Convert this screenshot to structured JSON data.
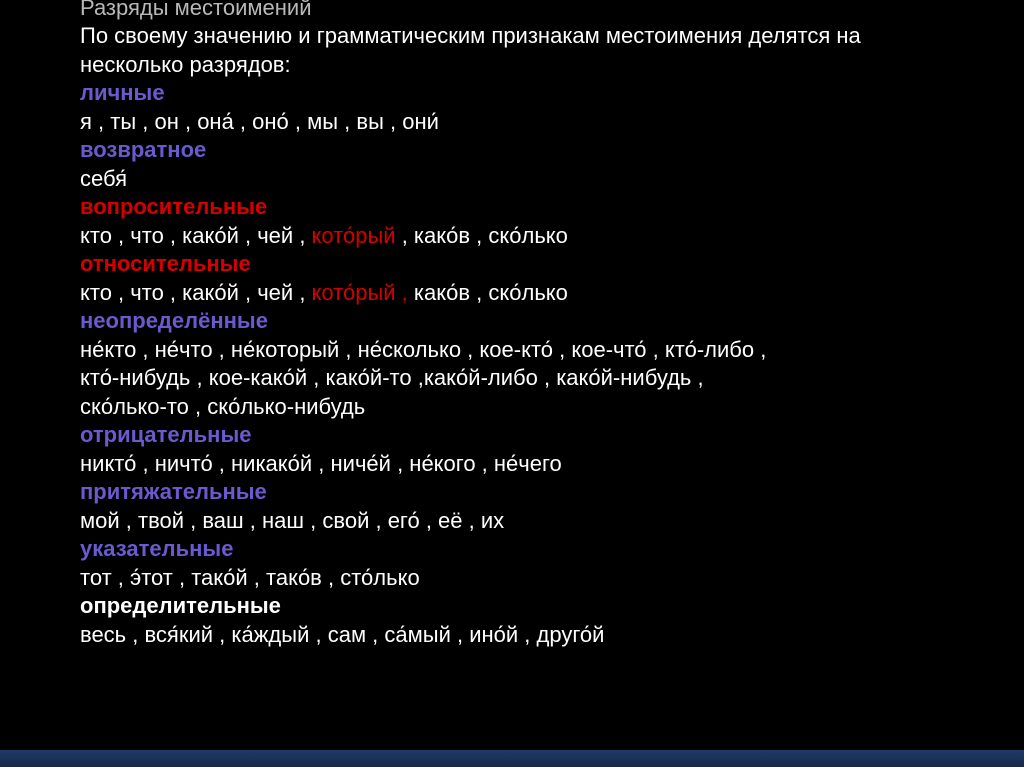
{
  "title_cut": "Разряды местоимений",
  "intro1": "По своему значению и грамматическим признакам местоимения делятся на",
  "intro2": "несколько разрядов:",
  "categories": {
    "personal": {
      "label": "личные",
      "items": "я , ты , он , она́ , оно́ , мы , вы , они́"
    },
    "reflexive": {
      "label": "возвратное",
      "items": "себя́"
    },
    "interrogative": {
      "label": "вопросительные",
      "items_pre": "кто , что , како́й , чей , ",
      "items_hl": "кото́рый",
      "items_post": " , како́в , ско́лько"
    },
    "relative": {
      "label": "относительные",
      "items_pre": "кто , что , како́й , чей , ",
      "items_hl": "кото́рый ,",
      "items_post": " како́в , ско́лько"
    },
    "indefinite": {
      "label": "неопределённые",
      "items1": "не́кто , не́что , не́который , не́сколько , кое-кто́ , кое-что́ , кто́-либо ,",
      "items2": "кто́-нибудь , кое-како́й , како́й-то ,како́й-либо , како́й-нибудь ,",
      "items3": "ско́лько-то , ско́лько-нибудь"
    },
    "negative": {
      "label": "отрицательные",
      "items": "никто́ , ничто́ , никако́й , ниче́й , не́кого , не́чего"
    },
    "possessive": {
      "label": "притяжательные",
      "items": "мой , твой , ваш , наш , свой , его́ , её , их"
    },
    "demonstrative": {
      "label": "указательные",
      "items": "тот , э́тот , тако́й , тако́в , сто́лько"
    },
    "definitive": {
      "label": "определительные",
      "items": "весь , вся́кий , ка́ждый , сам , са́мый , ино́й , друго́й"
    }
  }
}
